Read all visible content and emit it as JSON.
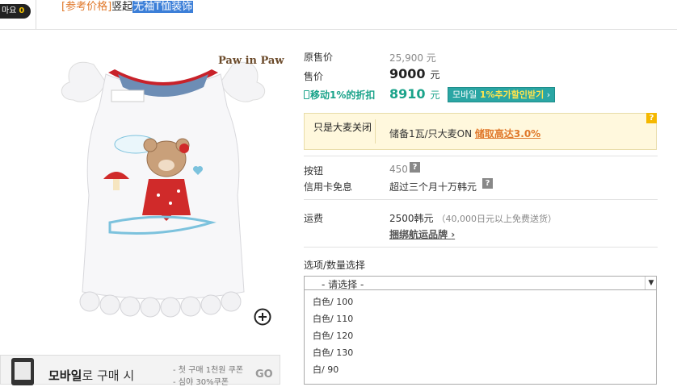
{
  "top": {
    "like_badge": "마요",
    "like_count": "0",
    "crumb_prefix": "[参考价格]",
    "crumb_mid": "竖起",
    "crumb_highlight": "无袖T恤装饰"
  },
  "product": {
    "brand": "Paw in Paw",
    "zoom_icon": "plus-circle-icon"
  },
  "mobile_banner": {
    "title_bold": "모바일",
    "title_rest": "로 구매 시",
    "coupon1": "- 첫 구매 1천원 쿠폰",
    "coupon2": "- 심야 30%쿠폰",
    "go": "GO"
  },
  "price": {
    "orig_label": "原售价",
    "orig_value": "25,900 元",
    "sale_label": "售价",
    "sale_value": "9000",
    "sale_unit": "元",
    "mobile_label": "移动1%的折扣",
    "mobile_value": "8910",
    "mobile_unit": "元",
    "mobile_btn_pre": "모바일 ",
    "mobile_btn_hl": "1%추가할인받기",
    "mobile_btn_arrow": "›"
  },
  "promo": {
    "left": "只是大麦关闭",
    "right_pre": "储备1瓦/只大麦ON ",
    "right_em": "储取高达3.0%",
    "q": "?"
  },
  "points": {
    "label": "按钮",
    "value": "450",
    "q": "?"
  },
  "installment": {
    "label": "信用卡免息",
    "value": "超过三个月十万韩元",
    "q": "?"
  },
  "shipping": {
    "label": "运费",
    "value": "2500韩元",
    "note": "（40,000日元以上免费送货）",
    "link": "捆绑航运品牌",
    "arrow": "›"
  },
  "options": {
    "label": "选项/数量选择",
    "placeholder": "- 请选择 -",
    "items": [
      "白色/ 100",
      "白色/ 110",
      "白色/ 120",
      "白色/ 130",
      "白/ 90"
    ]
  },
  "colors": {
    "accent_orange": "#e0782a",
    "mobile_green": "#1aa38a",
    "highlight_blue": "#3c7fd8"
  }
}
